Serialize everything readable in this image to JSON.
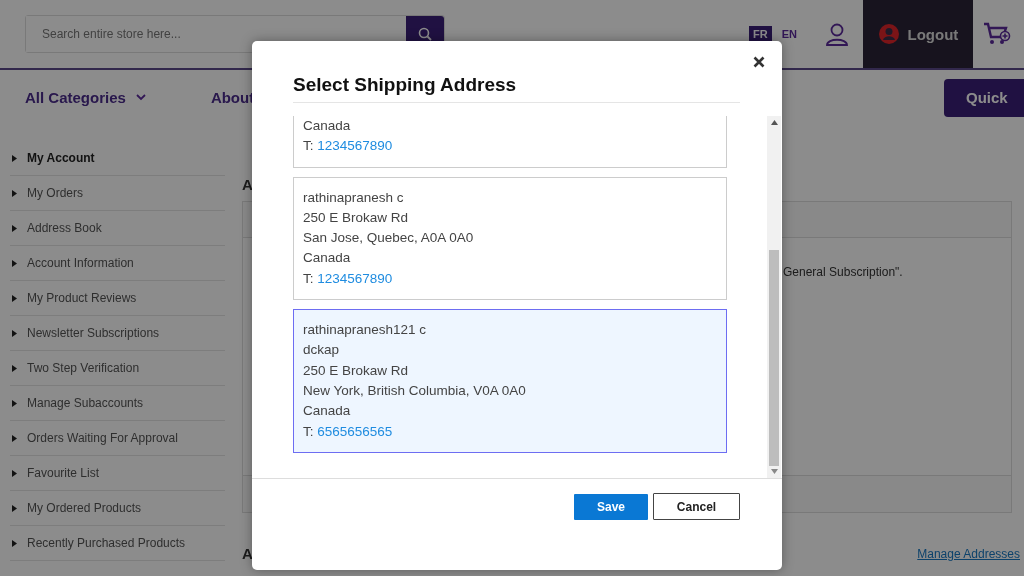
{
  "header": {
    "search": {
      "placeholder": "Search entire store here..."
    },
    "languages": [
      {
        "label": "FR",
        "selected": true
      },
      {
        "label": "EN",
        "selected": false
      }
    ],
    "logout": "Logout"
  },
  "nav": {
    "categories": "All Categories",
    "links": [
      "About"
    ],
    "quick_button": "Quick"
  },
  "sidebar": {
    "items": [
      {
        "label": "My Account",
        "selected": true
      },
      {
        "label": "My Orders",
        "selected": false
      },
      {
        "label": "Address Book",
        "selected": false
      },
      {
        "label": "Account Information",
        "selected": false
      },
      {
        "label": "My Product Reviews",
        "selected": false
      },
      {
        "label": "Newsletter Subscriptions",
        "selected": false
      },
      {
        "label": "Two Step Verification",
        "selected": false
      },
      {
        "label": "Manage Subaccounts",
        "selected": false
      },
      {
        "label": "Orders Waiting For Approval",
        "selected": false
      },
      {
        "label": "Favourite List",
        "selected": false
      },
      {
        "label": "My Ordered Products",
        "selected": false
      },
      {
        "label": "Recently Purchased Products",
        "selected": false
      }
    ]
  },
  "content": {
    "section_title": "A",
    "subscription_text": "General Subscription\".",
    "bottom_title": "A",
    "manage_link": "Manage Addresses"
  },
  "modal": {
    "title": "Select Shipping Address",
    "addresses": [
      {
        "lines": [
          "Canada"
        ],
        "phone_label": "T:",
        "phone": "1234567890",
        "selected": false,
        "cut_top": true
      },
      {
        "lines": [
          "rathinapranesh c",
          "250 E Brokaw Rd",
          "San Jose, Quebec, A0A 0A0",
          "Canada"
        ],
        "phone_label": "T:",
        "phone": "1234567890",
        "selected": false,
        "cut_top": false
      },
      {
        "lines": [
          "rathinapranesh121 c",
          "dckap",
          "250 E Brokaw Rd",
          "New York, British Columbia, V0A 0A0",
          "Canada"
        ],
        "phone_label": "T:",
        "phone": "6565656565",
        "selected": true,
        "cut_top": false
      }
    ],
    "buttons": [
      {
        "label": "Save",
        "kind": "primary"
      },
      {
        "label": "Cancel",
        "kind": "secondary"
      }
    ]
  }
}
